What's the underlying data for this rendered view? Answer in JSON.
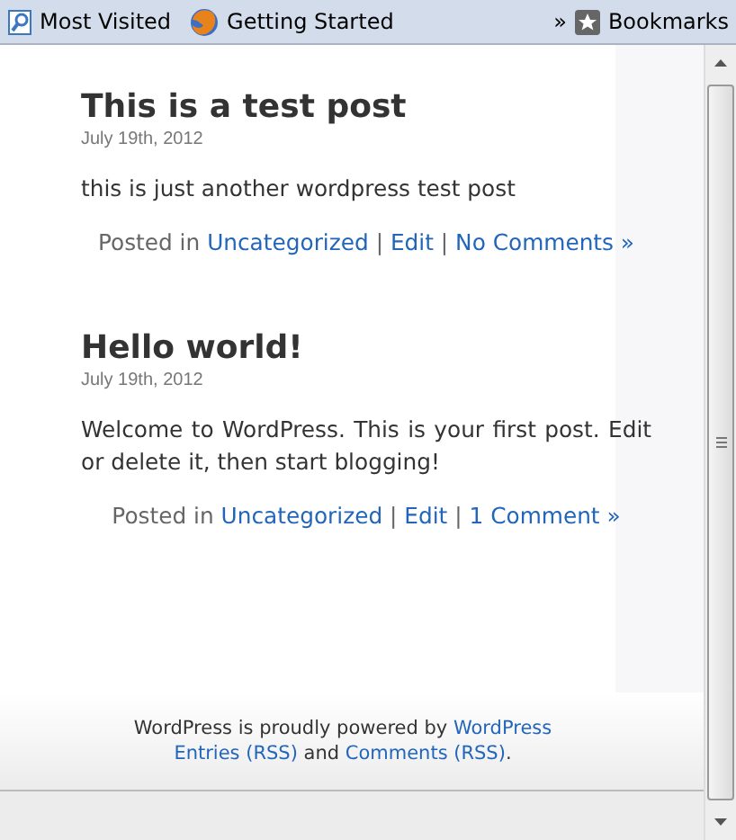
{
  "bookmarks_bar": {
    "items": [
      {
        "kind": "folder",
        "label": "Most Visited"
      },
      {
        "kind": "browser",
        "label": "Getting Started"
      }
    ],
    "overflow": "»",
    "bookmarks": "Bookmarks"
  },
  "posts": [
    {
      "title": "This is a test post",
      "date": "July 19th, 2012",
      "body": "this is just another wordpress test post",
      "posted_in": "Posted in",
      "category": "Uncategorized",
      "sep1": "|",
      "edit": "Edit",
      "sep2": "|",
      "comments": "No Comments »"
    },
    {
      "title": "Hello world!",
      "date": "July 19th, 2012",
      "body": "Welcome to WordPress. This is your first post. Edit or delete it, then start blogging!",
      "posted_in": "Posted in",
      "category": "Uncategorized",
      "sep1": "|",
      "edit": "Edit",
      "sep2": "|",
      "comments": "1 Comment »"
    }
  ],
  "footer": {
    "powered": "WordPress is proudly powered by",
    "wordpress_link": "WordPress",
    "entries_link": "Entries (RSS)",
    "and": "and",
    "comments_link": "Comments (RSS)",
    "period": "."
  }
}
